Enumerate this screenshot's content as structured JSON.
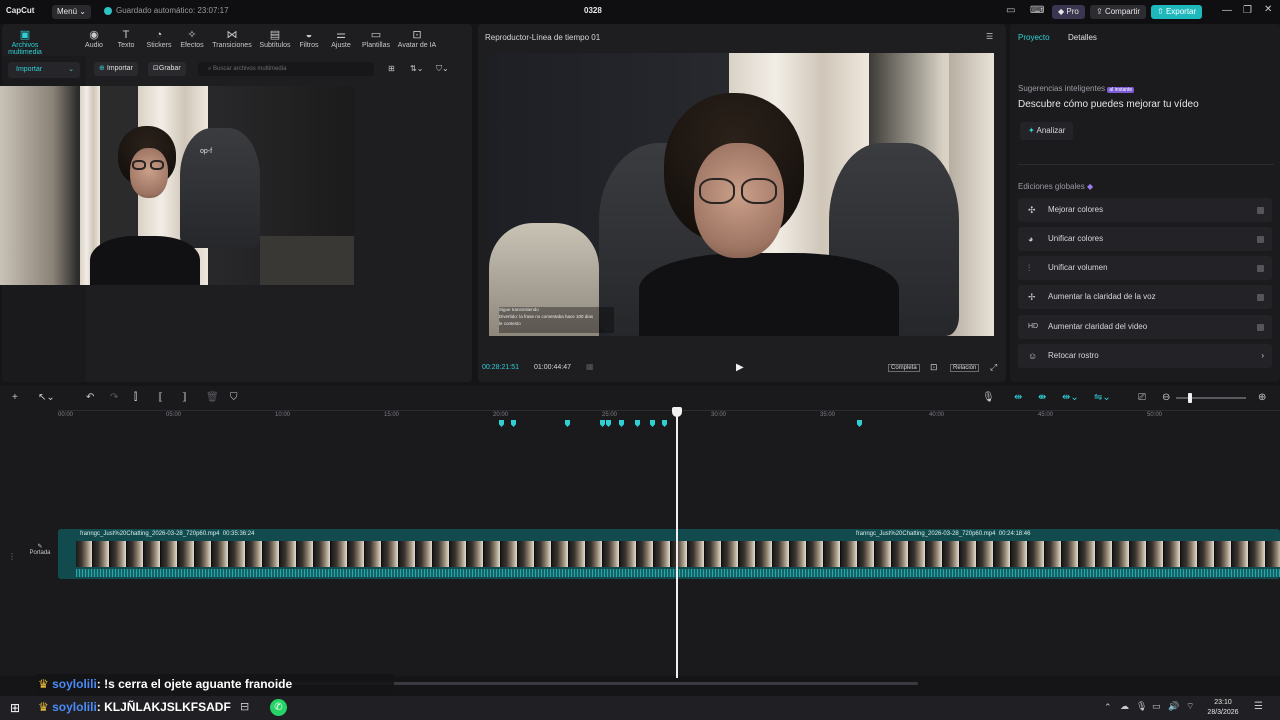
{
  "titlebar": {
    "logo": "CapCut",
    "menu_label": "Menú",
    "autosave": "Guardado automático: 23:07:17",
    "project_name": "0328",
    "pro_label": "Pro",
    "share_label": "Compartir",
    "export_label": "Exportar"
  },
  "media_toolbar": {
    "items": [
      {
        "label": "Archivos multimedia",
        "icon": "media-icon"
      },
      {
        "label": "Audio",
        "icon": "audio-icon"
      },
      {
        "label": "Texto",
        "icon": "text-icon"
      },
      {
        "label": "Stickers",
        "icon": "sticker-icon"
      },
      {
        "label": "Efectos",
        "icon": "effects-icon"
      },
      {
        "label": "Transiciones",
        "icon": "transitions-icon"
      },
      {
        "label": "Subtítulos",
        "icon": "subtitles-icon"
      },
      {
        "label": "Filtros",
        "icon": "filters-icon"
      },
      {
        "label": "Ajuste",
        "icon": "adjust-icon"
      },
      {
        "label": "Plantillas",
        "icon": "templates-icon"
      },
      {
        "label": "Avatar de IA",
        "icon": "avatar-icon"
      }
    ],
    "import_dropdown": "Importar",
    "import_button": "Importar",
    "record_button": "Grabar",
    "search_placeholder": "Buscar archivos multimedia"
  },
  "media_overlay_text": "op-f",
  "player": {
    "title": "Reproductor-Línea de tiempo 01",
    "current_time": "00:28:21:51",
    "total_time": "01:00:44:47",
    "ratio_full": "Completa",
    "ratio_label": "Relación",
    "caption_line1": "Sigue transmitiendo",
    "caption_line2": "Divertido: la frase no comentaba hace 100 dias",
    "caption_line3": "le contesto"
  },
  "props": {
    "tab_project": "Proyecto",
    "tab_details": "Detalles",
    "smart_title": "Sugerencias inteligentes",
    "smart_badge": "al instante",
    "smart_subtitle": "Descubre cómo puedes mejorar tu vídeo",
    "analyze_label": "Analizar",
    "global_title": "Ediciones globales",
    "rows": [
      {
        "label": "Mejorar colores"
      },
      {
        "label": "Unificar colores"
      },
      {
        "label": "Unificar volumen"
      },
      {
        "label": "Aumentar la claridad de la voz"
      },
      {
        "label": "Aumentar claridad del video"
      },
      {
        "label": "Retocar rostro"
      }
    ]
  },
  "timeline": {
    "ruler_labels": [
      "00:00",
      "05:00",
      "10:00",
      "15:00",
      "20:00",
      "25:00",
      "30:00",
      "35:00",
      "40:00",
      "45:00",
      "50:00"
    ],
    "cover_label": "Portada",
    "clip1_title": "franngc_Just%20Chatting_2026-03-28_720p60.mp4",
    "clip1_duration": "00:35:36:24",
    "clip2_title": "franngc_Just%20Chatting_2026-03-28_720p60.mp4",
    "clip2_duration": "00:24:18:46"
  },
  "chat": {
    "line1_user": "soylolili",
    "line1_msg": ": !s cerra el ojete aguante franoide",
    "line2_user": "soylolili",
    "line2_msg": ": KLJÑLAKJSLKFSADF"
  },
  "taskbar": {
    "time": "23:10",
    "date": "28/3/2026"
  }
}
